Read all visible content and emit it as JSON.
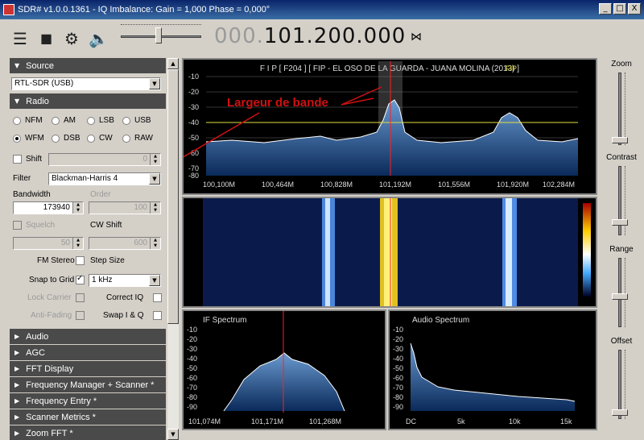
{
  "window": {
    "title": "SDR# v1.0.0.1361 - IQ Imbalance: Gain = 1,000 Phase = 0,000°",
    "minimize": "_",
    "maximize": "□",
    "close": "X"
  },
  "toolbar": {
    "menu_icon": "menu-icon",
    "stop_icon": "stop-icon",
    "settings_icon": "gear-icon",
    "audio_icon": "speaker-icon",
    "freq_dim": "000.",
    "freq_main": "101.200.000",
    "swap_icon": "swap-icon"
  },
  "left": {
    "source": {
      "title": "Source",
      "device": "RTL-SDR (USB)"
    },
    "radio": {
      "title": "Radio",
      "modes": [
        "NFM",
        "AM",
        "LSB",
        "USB",
        "WFM",
        "DSB",
        "CW",
        "RAW"
      ],
      "selected_mode": "WFM",
      "shift_label": "Shift",
      "shift_value": "0",
      "filter_label": "Filter",
      "filter_value": "Blackman-Harris 4",
      "bandwidth_label": "Bandwidth",
      "bandwidth_value": "173940",
      "order_label": "Order",
      "order_value": "100",
      "squelch_label": "Squelch",
      "squelch_value": "50",
      "cwshift_label": "CW Shift",
      "cwshift_value": "600",
      "fmstereo_label": "FM Stereo",
      "stepsize_label": "Step Size",
      "snap_label": "Snap to Grid",
      "step_value": "1 kHz",
      "lockcarrier_label": "Lock Carrier",
      "correctiq_label": "Correct IQ",
      "antifading_label": "Anti-Fading",
      "swapiq_label": "Swap I & Q"
    },
    "collapsed": [
      "Audio",
      "AGC",
      "FFT Display",
      "Frequency Manager + Scanner *",
      "Frequency Entry *",
      "Scanner Metrics *",
      "Zoom FFT *"
    ]
  },
  "spectrum": {
    "header": "F I P   [ F204 ]   [ FIP - EL OSO DE LA GUARDA - JUANA MOLINA (2013) ]",
    "station": "FIP",
    "annotation": "Largeur de bande",
    "y_labels": [
      "-10",
      "-20",
      "-30",
      "-40",
      "-50",
      "-60",
      "-70",
      "-80"
    ],
    "x_labels": [
      "100,100M",
      "100,464M",
      "100,828M",
      "101,192M",
      "101,556M",
      "101,920M",
      "102,284M"
    ]
  },
  "if_spectrum": {
    "title": "IF Spectrum",
    "y_labels": [
      "-10",
      "-20",
      "-30",
      "-40",
      "-50",
      "-60",
      "-70",
      "-80",
      "-90"
    ],
    "x_labels": [
      "101,074M",
      "101,171M",
      "101,268M"
    ]
  },
  "audio_spectrum": {
    "title": "Audio Spectrum",
    "y_labels": [
      "-10",
      "-20",
      "-30",
      "-40",
      "-50",
      "-60",
      "-70",
      "-80",
      "-90"
    ],
    "x_labels": [
      "DC",
      "5k",
      "10k",
      "15k"
    ]
  },
  "right": {
    "zoom": "Zoom",
    "contrast": "Contrast",
    "range": "Range",
    "offset": "Offset"
  },
  "colors": {
    "spectrum_fill": "#2a5a9a",
    "trace": "#ffffff",
    "marker": "#ff2020",
    "level_line": "#e0e040",
    "annotation": "#d01010"
  }
}
